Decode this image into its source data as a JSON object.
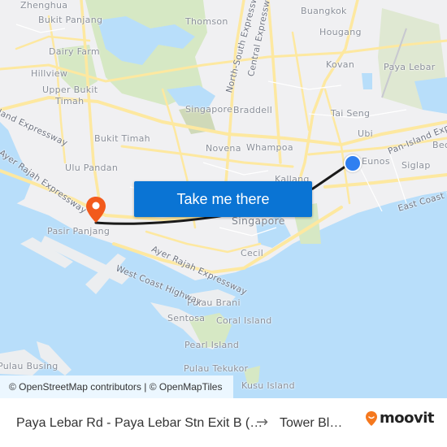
{
  "map": {
    "labels": [
      {
        "id": "zhenghua",
        "text": "Zhenghua",
        "type": "place"
      },
      {
        "id": "bukit-panjang",
        "text": "Bukit Panjang",
        "type": "place"
      },
      {
        "id": "dairy-farm",
        "text": "Dairy Farm",
        "type": "place"
      },
      {
        "id": "hillview",
        "text": "Hillview",
        "type": "place"
      },
      {
        "id": "upper-bukit-timah-1",
        "text": "Upper Bukit",
        "type": "place"
      },
      {
        "id": "upper-bukit-timah-2",
        "text": "Timah",
        "type": "place"
      },
      {
        "id": "thomson",
        "text": "Thomson",
        "type": "place"
      },
      {
        "id": "buangkok",
        "text": "Buangkok",
        "type": "place"
      },
      {
        "id": "hougang",
        "text": "Hougang",
        "type": "place"
      },
      {
        "id": "kovan",
        "text": "Kovan",
        "type": "place"
      },
      {
        "id": "paya-lebar",
        "text": "Paya Lebar",
        "type": "place"
      },
      {
        "id": "tai-seng",
        "text": "Tai Seng",
        "type": "place"
      },
      {
        "id": "ubi",
        "text": "Ubi",
        "type": "place"
      },
      {
        "id": "eunos",
        "text": "Eunos",
        "type": "place"
      },
      {
        "id": "siglap",
        "text": "Siglap",
        "type": "place"
      },
      {
        "id": "bedok",
        "text": "Bec",
        "type": "place"
      },
      {
        "id": "singapore-reservoir",
        "text": "Singapore",
        "type": "place"
      },
      {
        "id": "braddell",
        "text": "Braddell",
        "type": "place"
      },
      {
        "id": "bukit-timah",
        "text": "Bukit Timah",
        "type": "place"
      },
      {
        "id": "novena",
        "text": "Novena",
        "type": "place"
      },
      {
        "id": "whampoa",
        "text": "Whampoa",
        "type": "place"
      },
      {
        "id": "kallang",
        "text": "Kallang",
        "type": "place"
      },
      {
        "id": "ulu-pandan",
        "text": "Ulu Pandan",
        "type": "place"
      },
      {
        "id": "pasir-panjang",
        "text": "Pasir Panjang",
        "type": "place"
      },
      {
        "id": "singapore",
        "text": "Singapore",
        "type": "city"
      },
      {
        "id": "cecil",
        "text": "Cecil",
        "type": "place"
      },
      {
        "id": "pulau-brani",
        "text": "Pulau Brani",
        "type": "place"
      },
      {
        "id": "sentosa",
        "text": "Sentosa",
        "type": "place"
      },
      {
        "id": "coral-island",
        "text": "Coral Island",
        "type": "place"
      },
      {
        "id": "pearl-island",
        "text": "Pearl Island",
        "type": "place"
      },
      {
        "id": "pulau-busing",
        "text": "Pulau Busing",
        "type": "place"
      },
      {
        "id": "pulau-tekukor",
        "text": "Pulau Tekukor",
        "type": "place"
      },
      {
        "id": "kusu-island",
        "text": "Kusu Island",
        "type": "place"
      },
      {
        "id": "north-south-expressway",
        "text": "North-South Expressway",
        "type": "road"
      },
      {
        "id": "central-expressway",
        "text": "Central Expressway",
        "type": "road"
      },
      {
        "id": "pan-island-expressway-east",
        "text": "Pan-Island Expressway",
        "type": "road"
      },
      {
        "id": "pan-island-expressway-west",
        "text": "Island Expressway",
        "type": "road"
      },
      {
        "id": "east-coast-parkway",
        "text": "East Coast P",
        "type": "road"
      },
      {
        "id": "ayer-rajah-expressway-west",
        "text": "Ayer Rajah Expressway",
        "type": "road"
      },
      {
        "id": "ayer-rajah-expressway",
        "text": "Ayer Rajah Expressway",
        "type": "road"
      },
      {
        "id": "west-coast-highway",
        "text": "West Coast Highway",
        "type": "road"
      }
    ],
    "cta_label": "Take me there",
    "attribution": "© OpenStreetMap contributors | © OpenMapTiles",
    "colors": {
      "land": "#f0f0f2",
      "water": "#b8defa",
      "park": "#d6e8c4",
      "road": "#fde8a0",
      "route": "#1a1a1a",
      "cta": "#0a74d4",
      "origin": "#2f7ff0",
      "destination": "#f25a1c"
    }
  },
  "footer": {
    "from": "Paya Lebar Rd - Paya Lebar Stn Exit B (…",
    "arrow": "→",
    "to": "Tower Bl…",
    "brand": "moovit",
    "brand_color": "#f5781e"
  }
}
